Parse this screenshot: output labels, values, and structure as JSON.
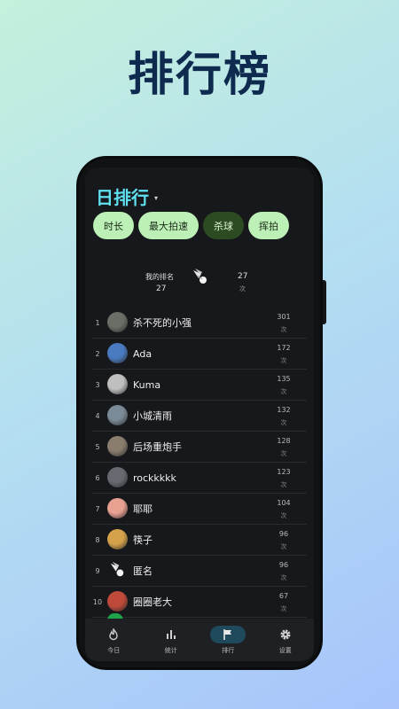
{
  "headline": "排行榜",
  "screen": {
    "title": "日排行",
    "caret": "▾",
    "chips": [
      {
        "label": "时长",
        "selected": false
      },
      {
        "label": "最大拍速",
        "selected": false
      },
      {
        "label": "杀球",
        "selected": true
      },
      {
        "label": "挥拍",
        "selected": false
      }
    ],
    "my_rank": {
      "label": "我的排名",
      "value": "27",
      "count": "27",
      "unit": "次",
      "icon": "shuttlecock-icon"
    },
    "leaderboard": [
      {
        "rank": "1",
        "name": "杀不死的小强",
        "score": "301",
        "unit": "次",
        "avatar_color": "#6a6e66"
      },
      {
        "rank": "2",
        "name": "Ada",
        "score": "172",
        "unit": "次",
        "avatar_color": "#4a7ac0"
      },
      {
        "rank": "3",
        "name": "Kuma",
        "score": "135",
        "unit": "次",
        "avatar_color": "#bfbfbf"
      },
      {
        "rank": "4",
        "name": "小城清雨",
        "score": "132",
        "unit": "次",
        "avatar_color": "#7a8a96"
      },
      {
        "rank": "5",
        "name": "后场重炮手",
        "score": "128",
        "unit": "次",
        "avatar_color": "#8a7d6e"
      },
      {
        "rank": "6",
        "name": "rockkkkk",
        "score": "123",
        "unit": "次",
        "avatar_color": "#666a70"
      },
      {
        "rank": "7",
        "name": "耶耶",
        "score": "104",
        "unit": "次",
        "avatar_color": "#e8a090"
      },
      {
        "rank": "8",
        "name": "筷子",
        "score": "96",
        "unit": "次",
        "avatar_color": "#d4a24a"
      },
      {
        "rank": "9",
        "name": "匿名",
        "score": "96",
        "unit": "次",
        "avatar_color": "shuttlecock"
      },
      {
        "rank": "10",
        "name": "圈圈老大",
        "score": "67",
        "unit": "次",
        "avatar_color": "#c04a3a"
      }
    ],
    "tabs": [
      {
        "label": "今日",
        "icon": "flame-icon",
        "active": false
      },
      {
        "label": "统计",
        "icon": "bar-chart-icon",
        "active": false
      },
      {
        "label": "排行",
        "icon": "flag-icon",
        "active": true
      },
      {
        "label": "设置",
        "icon": "gear-icon",
        "active": false
      }
    ]
  }
}
